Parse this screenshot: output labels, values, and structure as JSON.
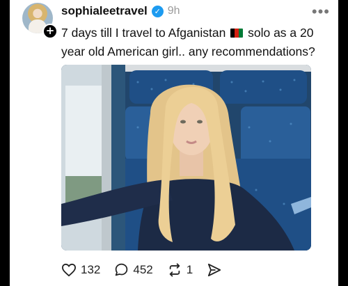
{
  "post": {
    "username": "sophialeetravel",
    "time": "9h",
    "text_before_flag": "7 days till I travel to Afganistan ",
    "text_after_flag": " solo as a 20 year old American girl.. any recommendations?"
  },
  "icons": {
    "verified": "verified-check-icon",
    "more": "more-dots-icon",
    "add": "plus-icon",
    "like": "heart-icon",
    "reply": "speech-bubble-icon",
    "repost": "repost-icon",
    "share": "send-icon"
  },
  "actions": {
    "likes": "132",
    "replies": "452",
    "reposts": "1"
  },
  "colors": {
    "verified": "#1d9bf0",
    "seat_blue": "#1f4f86"
  }
}
